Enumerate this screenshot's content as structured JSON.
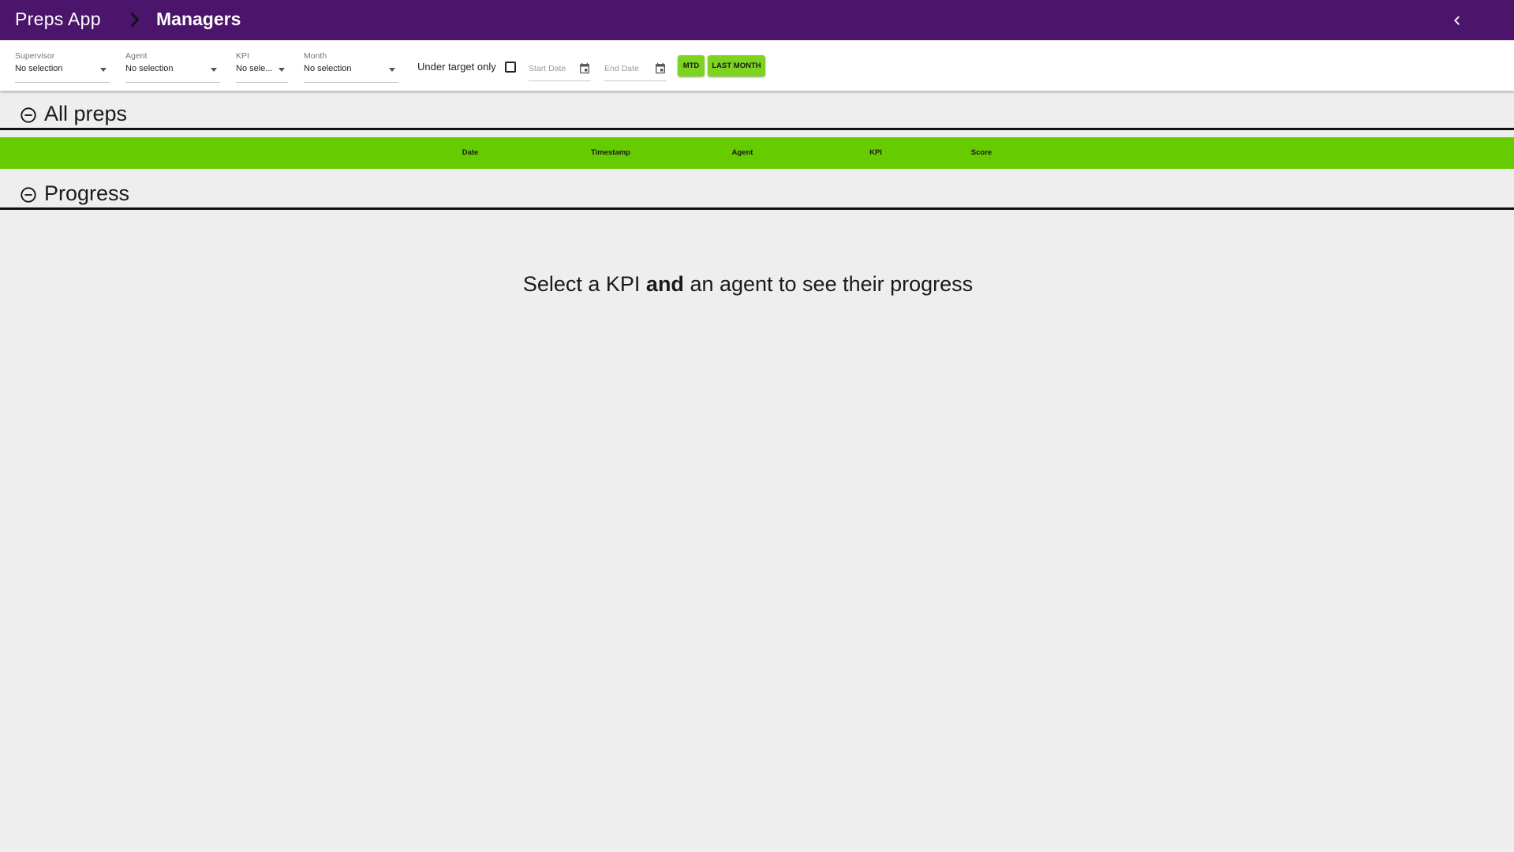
{
  "header": {
    "app_title": "Preps App",
    "page_title": "Managers",
    "background_color": "#4a156b",
    "breadcrumb_icon": "chevron-right-icon",
    "collapse_icon": "chevron-left-icon"
  },
  "filters": {
    "supervisor": {
      "label": "Supervisor",
      "value": "No selection"
    },
    "agent": {
      "label": "Agent",
      "value": "No selection"
    },
    "kpi": {
      "label": "KPI",
      "value": "No sele..."
    },
    "month": {
      "label": "Month",
      "value": "No selection"
    },
    "under_target": {
      "label": "Under target only",
      "checked": false
    },
    "start_date": {
      "placeholder": "Start Date"
    },
    "end_date": {
      "placeholder": "End Date"
    },
    "buttons": {
      "mtd": "MTD",
      "last_month": "LAST MONTH"
    },
    "button_color": "#7ed321"
  },
  "sections": {
    "all_preps": {
      "title": "All preps",
      "toggle_icon": "minus-circle-icon",
      "columns": [
        "Date",
        "Timestamp",
        "Agent",
        "KPI",
        "Score"
      ],
      "header_color": "#66cc00"
    },
    "progress": {
      "title": "Progress",
      "toggle_icon": "minus-circle-icon",
      "message": {
        "before": "Select a KPI ",
        "emphasis": "and",
        "after": " an agent to see their progress"
      }
    }
  }
}
